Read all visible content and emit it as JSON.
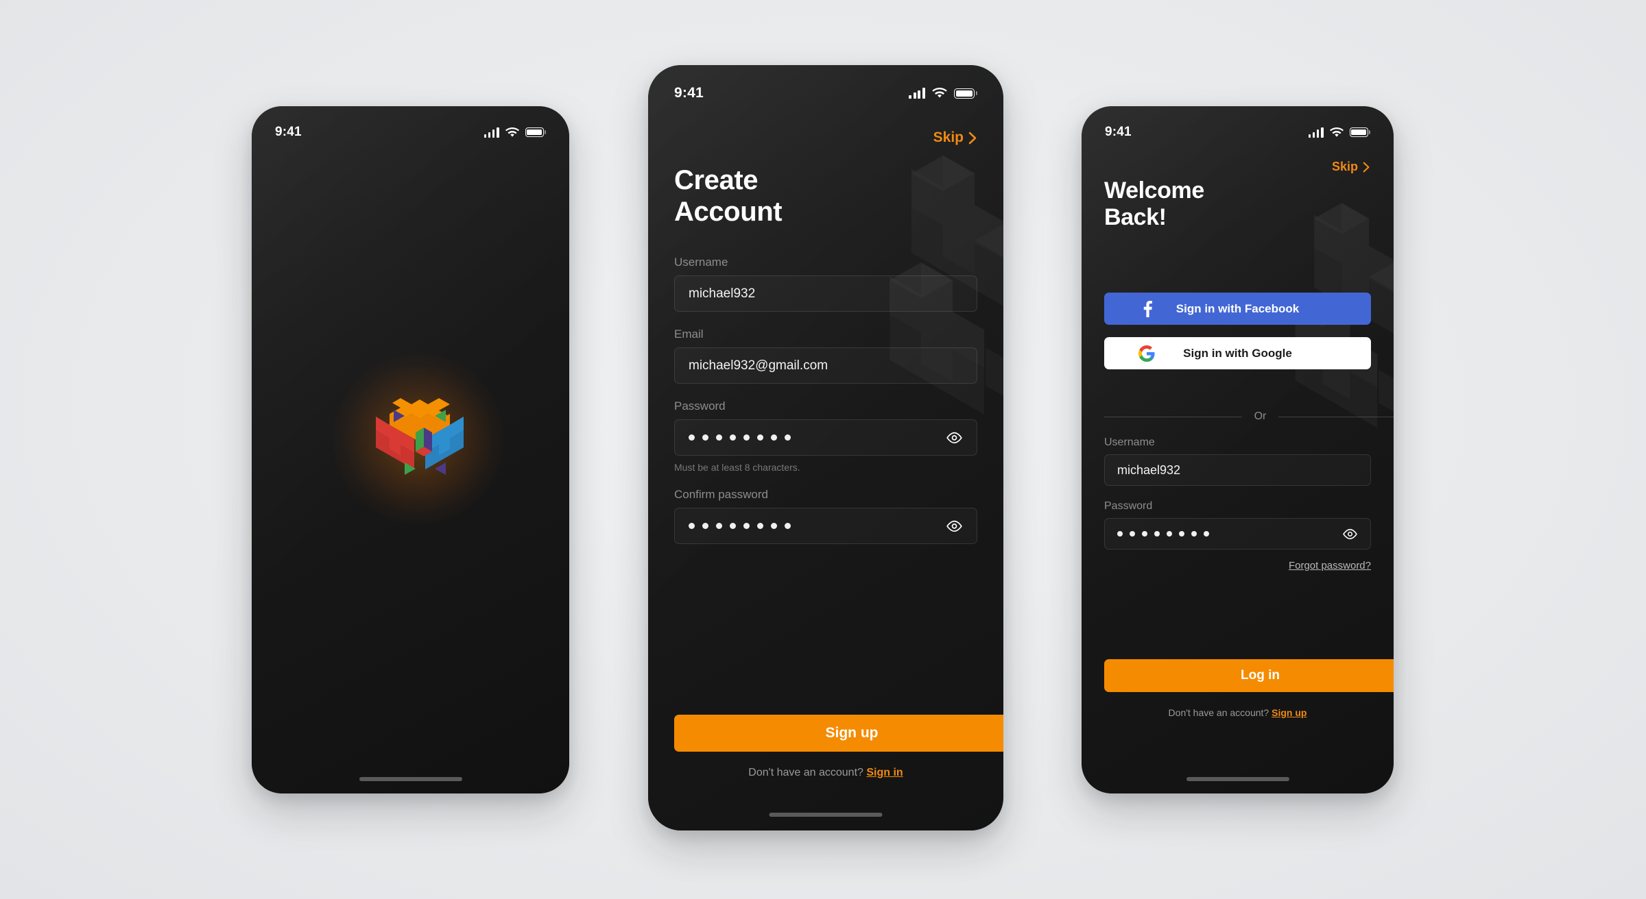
{
  "canvas": {
    "background": "#eceef0"
  },
  "colors": {
    "accent_orange": "#f58b00",
    "facebook_blue": "#4267d5",
    "google_white": "#ffffff",
    "screen_dark": "#191919",
    "label_gray": "#8d8d8e"
  },
  "status_bar": {
    "time": "9:41",
    "signal_icon": "cellular-signal-icon",
    "wifi_icon": "wifi-icon",
    "battery_icon": "battery-icon"
  },
  "screens": [
    {
      "id": "splash",
      "name": "Splash Screen",
      "logo_name": "app-logo-isometric-cube",
      "logo_colors": {
        "top": "#f59100",
        "left": "#d93a33",
        "right": "#2e8fcf",
        "green": "#3da14a",
        "purple": "#4c3a86"
      }
    },
    {
      "id": "create-account",
      "name": "Create Account Screen",
      "skip_label": "Skip",
      "skip_chevron_icon": "chevron-right-icon",
      "title": "Create\nAccount",
      "fields": [
        {
          "label": "Username",
          "value": "michael932",
          "type": "text",
          "placeholder": "Username"
        },
        {
          "label": "Email",
          "value": "michael932@gmail.com",
          "type": "text",
          "placeholder": "Email"
        },
        {
          "label": "Password",
          "value": "",
          "masked_length": 8,
          "type": "password",
          "placeholder": "Password",
          "toggle_icon": "eye-icon",
          "helper": "Must be at least 8 characters."
        },
        {
          "label": "Confirm password",
          "value": "",
          "masked_length": 8,
          "type": "password",
          "placeholder": "Confirm password",
          "toggle_icon": "eye-icon"
        }
      ],
      "primary_button": "Sign up",
      "footer_text": "Don't have an account?",
      "footer_link": "Sign in"
    },
    {
      "id": "welcome-back",
      "name": "Welcome Back Login Screen",
      "skip_label": "Skip",
      "skip_chevron_icon": "chevron-right-icon",
      "title": "Welcome\nBack!",
      "social_buttons": [
        {
          "label": "Sign in with Facebook",
          "provider": "facebook",
          "icon": "facebook-icon"
        },
        {
          "label": "Sign in with Google",
          "provider": "google",
          "icon": "google-icon"
        }
      ],
      "divider_text": "Or",
      "fields": [
        {
          "label": "Username",
          "value": "michael932",
          "type": "text",
          "placeholder": "Username"
        },
        {
          "label": "Password",
          "value": "",
          "masked_length": 8,
          "type": "password",
          "placeholder": "Password",
          "toggle_icon": "eye-icon"
        }
      ],
      "forgot_link": "Forgot password?",
      "primary_button": "Log in",
      "footer_text": "Don't have an account?",
      "footer_link": "Sign up"
    }
  ]
}
